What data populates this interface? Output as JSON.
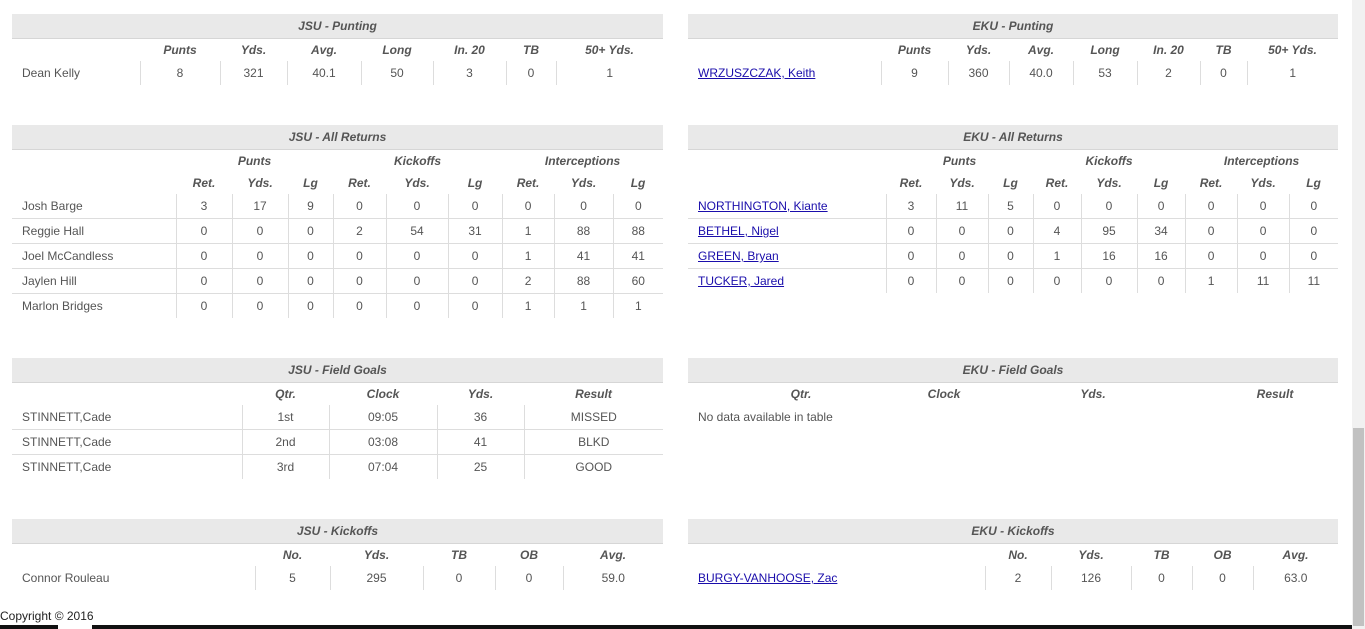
{
  "punting": {
    "headers": [
      "",
      "Punts",
      "Yds.",
      "Avg.",
      "Long",
      "In. 20",
      "TB",
      "50+ Yds."
    ],
    "jsu": {
      "title": "JSU - Punting",
      "rows": [
        {
          "name": "Dean Kelly",
          "vals": [
            "8",
            "321",
            "40.1",
            "50",
            "3",
            "0",
            "1"
          ]
        }
      ]
    },
    "eku": {
      "title": "EKU - Punting",
      "rows": [
        {
          "name": "WRZUSZCZAK, Keith",
          "vals": [
            "9",
            "360",
            "40.0",
            "53",
            "2",
            "0",
            "1"
          ]
        }
      ]
    }
  },
  "returns": {
    "groups": [
      "Punts",
      "Kickoffs",
      "Interceptions"
    ],
    "headers": [
      "Ret.",
      "Yds.",
      "Lg",
      "Ret.",
      "Yds.",
      "Lg",
      "Ret.",
      "Yds.",
      "Lg"
    ],
    "jsu": {
      "title": "JSU - All Returns",
      "rows": [
        {
          "name": "Josh Barge",
          "vals": [
            "3",
            "17",
            "9",
            "0",
            "0",
            "0",
            "0",
            "0",
            "0"
          ]
        },
        {
          "name": "Reggie Hall",
          "vals": [
            "0",
            "0",
            "0",
            "2",
            "54",
            "31",
            "1",
            "88",
            "88"
          ]
        },
        {
          "name": "Joel McCandless",
          "vals": [
            "0",
            "0",
            "0",
            "0",
            "0",
            "0",
            "1",
            "41",
            "41"
          ]
        },
        {
          "name": "Jaylen Hill",
          "vals": [
            "0",
            "0",
            "0",
            "0",
            "0",
            "0",
            "2",
            "88",
            "60"
          ]
        },
        {
          "name": "Marlon Bridges",
          "vals": [
            "0",
            "0",
            "0",
            "0",
            "0",
            "0",
            "1",
            "1",
            "1"
          ]
        }
      ]
    },
    "eku": {
      "title": "EKU - All Returns",
      "rows": [
        {
          "name": "NORTHINGTON, Kiante",
          "vals": [
            "3",
            "11",
            "5",
            "0",
            "0",
            "0",
            "0",
            "0",
            "0"
          ]
        },
        {
          "name": "BETHEL, Nigel",
          "vals": [
            "0",
            "0",
            "0",
            "4",
            "95",
            "34",
            "0",
            "0",
            "0"
          ]
        },
        {
          "name": "GREEN, Bryan",
          "vals": [
            "0",
            "0",
            "0",
            "1",
            "16",
            "16",
            "0",
            "0",
            "0"
          ]
        },
        {
          "name": "TUCKER, Jared",
          "vals": [
            "0",
            "0",
            "0",
            "0",
            "0",
            "0",
            "1",
            "11",
            "11"
          ]
        }
      ]
    }
  },
  "fieldgoals": {
    "headers": [
      "Qtr.",
      "Clock",
      "Yds.",
      "Result"
    ],
    "jsu": {
      "title": "JSU - Field Goals",
      "rows": [
        {
          "name": "STINNETT,Cade",
          "vals": [
            "1st",
            "09:05",
            "36",
            "MISSED"
          ]
        },
        {
          "name": "STINNETT,Cade",
          "vals": [
            "2nd",
            "03:08",
            "41",
            "BLKD"
          ]
        },
        {
          "name": "STINNETT,Cade",
          "vals": [
            "3rd",
            "07:04",
            "25",
            "GOOD"
          ]
        }
      ]
    },
    "eku": {
      "title": "EKU - Field Goals",
      "empty": "No data available in table"
    }
  },
  "kickoffs": {
    "headers": [
      "No.",
      "Yds.",
      "TB",
      "OB",
      "Avg."
    ],
    "jsu": {
      "title": "JSU - Kickoffs",
      "rows": [
        {
          "name": "Connor Rouleau",
          "vals": [
            "5",
            "295",
            "0",
            "0",
            "59.0"
          ]
        }
      ]
    },
    "eku": {
      "title": "EKU - Kickoffs",
      "rows": [
        {
          "name": "BURGY-VANHOOSE, Zac",
          "vals": [
            "2",
            "126",
            "0",
            "0",
            "63.0"
          ]
        }
      ]
    }
  },
  "footer": {
    "copyright": "Copyright © 2016"
  }
}
